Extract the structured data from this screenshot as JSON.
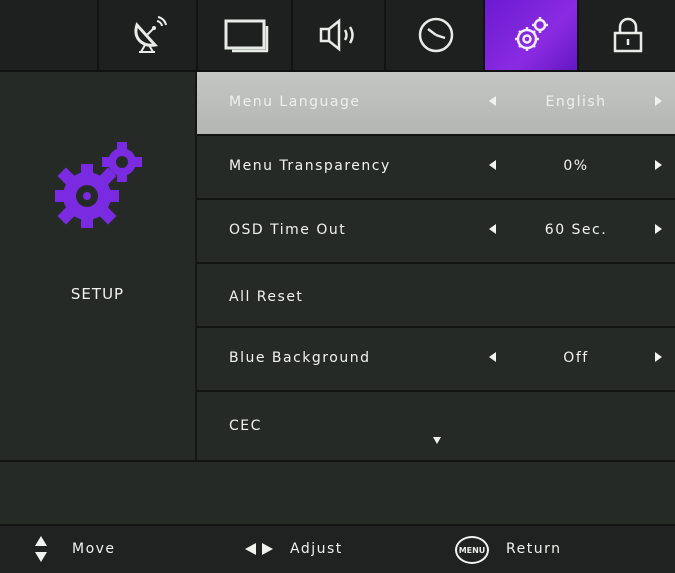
{
  "tabs": [
    {
      "icon": "satellite-dish-icon"
    },
    {
      "icon": "picture-icon"
    },
    {
      "icon": "speaker-icon"
    },
    {
      "icon": "clock-icon"
    },
    {
      "icon": "gear-icon",
      "active": true
    },
    {
      "icon": "lock-icon"
    }
  ],
  "left_panel": {
    "icon": "gears-icon",
    "label": "SETUP"
  },
  "menu": {
    "items": [
      {
        "label": "Menu Language",
        "value": "English",
        "selected": true
      },
      {
        "label": "Menu Transparency",
        "value": "0%"
      },
      {
        "label": "OSD Time Out",
        "value": "60 Sec."
      },
      {
        "label": "All Reset",
        "value": ""
      },
      {
        "label": "Blue Background",
        "value": "Off"
      },
      {
        "label": "CEC",
        "value": ""
      }
    ]
  },
  "footer": {
    "move_label": "Move",
    "adjust_label": "Adjust",
    "menu_badge": "MENU",
    "return_label": "Return"
  },
  "colors": {
    "accent": "#8a2be2",
    "selected_row": "#bdbfbd",
    "background": "#262a27"
  }
}
